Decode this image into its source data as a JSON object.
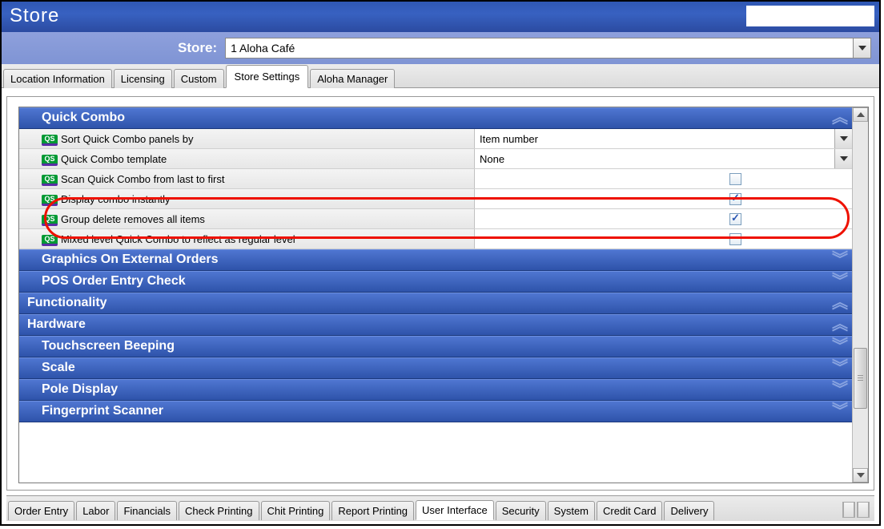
{
  "title": "Store",
  "storeLabel": "Store:",
  "storeValue": "1 Aloha Café",
  "topTabs": [
    "Location Information",
    "Licensing",
    "Custom",
    "Store Settings",
    "Aloha Manager"
  ],
  "topTabActive": 3,
  "sections": {
    "quickCombo": {
      "title": "Quick Combo",
      "rows": [
        {
          "label": "Sort Quick Combo panels by",
          "type": "dropdown",
          "value": "Item number"
        },
        {
          "label": "Quick Combo template",
          "type": "dropdown",
          "value": "None"
        },
        {
          "label": "Scan Quick Combo from last to first",
          "type": "check",
          "checked": false
        },
        {
          "label": "Display combo instantly",
          "type": "check",
          "checked": true
        },
        {
          "label": "Group delete removes all items",
          "type": "check",
          "checked": true
        },
        {
          "label": "Mixed level Quick Combo to reflect as regular level",
          "type": "check",
          "checked": false
        }
      ]
    },
    "others": [
      {
        "title": "Graphics On External Orders",
        "indent": 1
      },
      {
        "title": "POS Order Entry Check",
        "indent": 1
      },
      {
        "title": "Functionality",
        "indent": 0
      },
      {
        "title": "Hardware",
        "indent": 0
      },
      {
        "title": "Touchscreen Beeping",
        "indent": 1
      },
      {
        "title": "Scale",
        "indent": 1
      },
      {
        "title": "Pole Display",
        "indent": 1
      },
      {
        "title": "Fingerprint Scanner",
        "indent": 1
      }
    ]
  },
  "bottomTabs": [
    "Order Entry",
    "Labor",
    "Financials",
    "Check Printing",
    "Chit Printing",
    "Report Printing",
    "User Interface",
    "Security",
    "System",
    "Credit Card",
    "Delivery"
  ],
  "bottomTabActive": 6
}
